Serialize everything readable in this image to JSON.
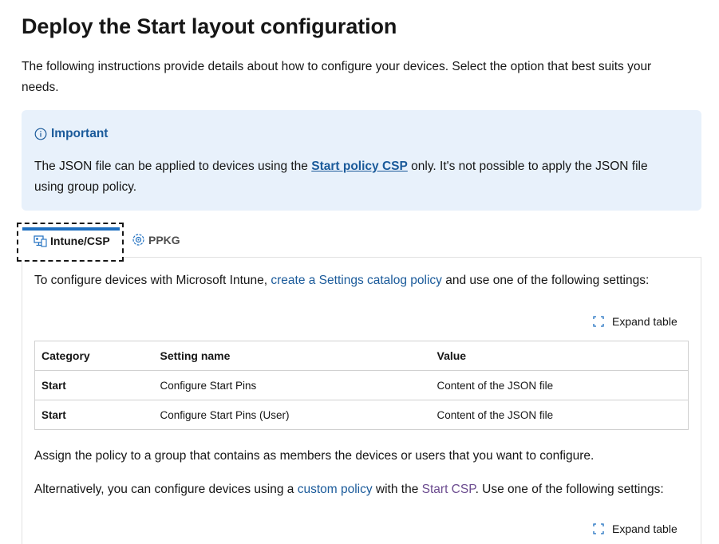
{
  "page": {
    "title": "Deploy the Start layout configuration",
    "intro": "The following instructions provide details about how to configure your devices. Select the option that best suits your needs."
  },
  "alert": {
    "heading": "Important",
    "text_before": "The JSON file can be applied to devices using the ",
    "link": "Start policy CSP",
    "text_after": " only. It's not possible to apply the JSON file using group policy."
  },
  "tabs": [
    {
      "label": "Intune/CSP",
      "icon": "intune-icon",
      "selected": true
    },
    {
      "label": "PPKG",
      "icon": "ppkg-icon",
      "selected": false
    }
  ],
  "panel": {
    "p1_before": "To configure devices with Microsoft Intune, ",
    "p1_link": "create a Settings catalog policy",
    "p1_after": " and use one of the following settings:",
    "expand_label": "Expand table",
    "table": {
      "headers": [
        "Category",
        "Setting name",
        "Value"
      ],
      "rows": [
        [
          "Start",
          "Configure Start Pins",
          "Content of the JSON file"
        ],
        [
          "Start",
          "Configure Start Pins (User)",
          "Content of the JSON file"
        ]
      ]
    },
    "p2": "Assign the policy to a group that contains as members the devices or users that you want to configure.",
    "p3_before": "Alternatively, you can configure devices using a ",
    "p3_link1": "custom policy",
    "p3_mid": " with the ",
    "p3_link2": "Start CSP",
    "p3_after": ". Use one of the following settings:",
    "expand_label_2": "Expand table"
  },
  "colors": {
    "link": "#1a5a9a",
    "visited_link": "#6b4b8f",
    "alert_bg": "#e8f1fb",
    "tab_accent": "#1e6fc0"
  }
}
